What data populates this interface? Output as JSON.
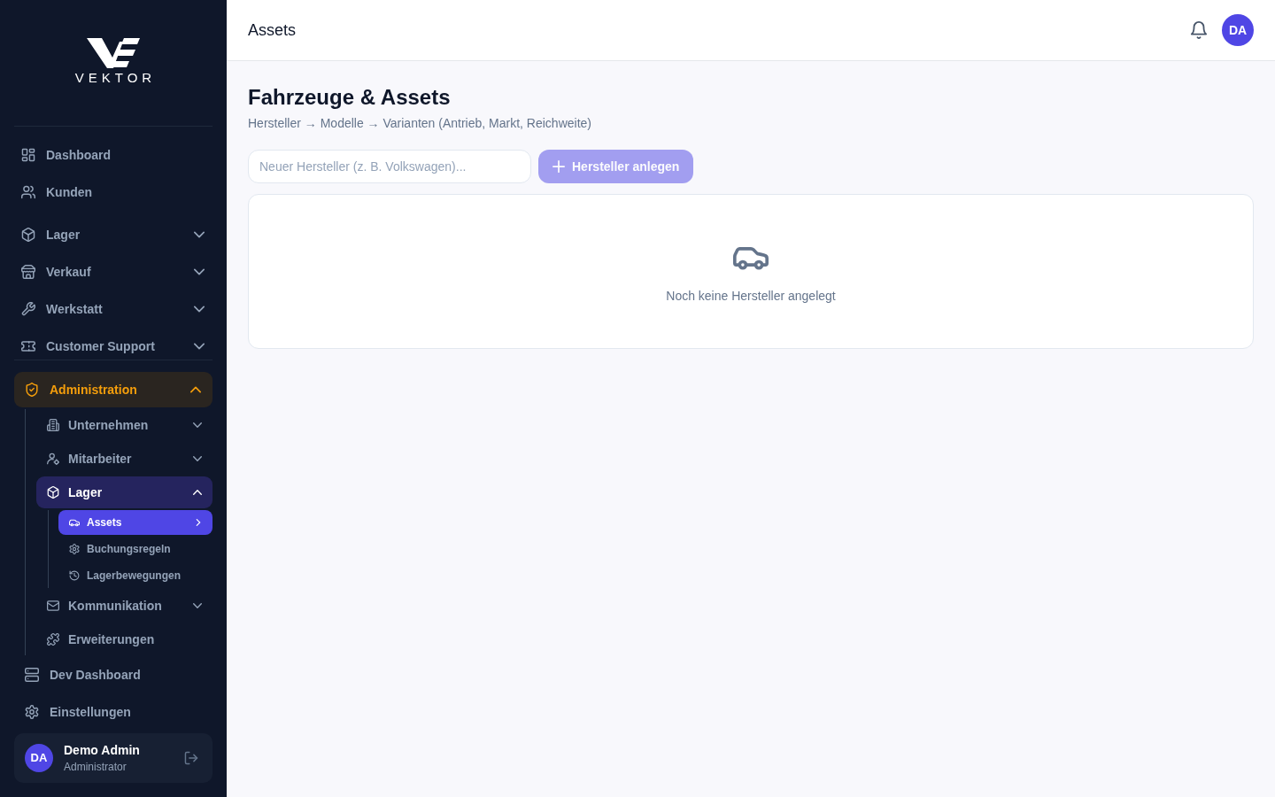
{
  "sidebar": {
    "logo": {
      "wordmark": "VEKTOR"
    },
    "main_nav": [
      [
        {
          "label": "Dashboard",
          "selected": false
        },
        {
          "label": "Kunden",
          "selected": false
        }
      ],
      [
        {
          "label": "Lager",
          "selected": false,
          "expanded": false
        },
        {
          "label": "Verkauf",
          "selected": false,
          "expanded": false
        },
        {
          "label": "Werkstatt",
          "selected": false,
          "expanded": false
        },
        {
          "label": "Customer Support",
          "selected": false,
          "expanded": false
        }
      ]
    ],
    "admin_nav": [
      {
        "label": "Administration",
        "selected": true,
        "expanded": true,
        "children": [
          {
            "label": "Unternehmen",
            "selected": false,
            "expanded": false
          },
          {
            "label": "Mitarbeiter",
            "selected": false,
            "expanded": false
          },
          {
            "label": "Lager",
            "selected": true,
            "expanded": true,
            "children": [
              {
                "label": "Assets",
                "selected": true
              },
              {
                "label": "Buchungsregeln",
                "selected": false
              },
              {
                "label": "Lagerbewegungen",
                "selected": false
              }
            ]
          },
          {
            "label": "Kommunikation",
            "selected": false,
            "expanded": false
          },
          {
            "label": "Erweiterungen",
            "selected": false
          }
        ]
      },
      {
        "label": "Dev Dashboard",
        "selected": false
      },
      {
        "label": "Einstellungen",
        "selected": false
      }
    ],
    "user": {
      "initials": "DA",
      "name": "Demo Admin",
      "role": "Administrator"
    }
  },
  "topbar": {
    "title": "Assets",
    "avatar_initials": "DA"
  },
  "page": {
    "title": "Fahrzeuge & Assets",
    "subtitle": "Hersteller → Modelle → Varianten (Antrieb, Markt, Reichweite)",
    "manufacturer_field": {
      "placeholder": "Neuer Hersteller (z. B. Volkswagen)..."
    },
    "create_button": {
      "label": "Hersteller anlegen",
      "disabled": true
    },
    "empty_state": {
      "message": "Noch keine Hersteller angelegt"
    }
  }
}
